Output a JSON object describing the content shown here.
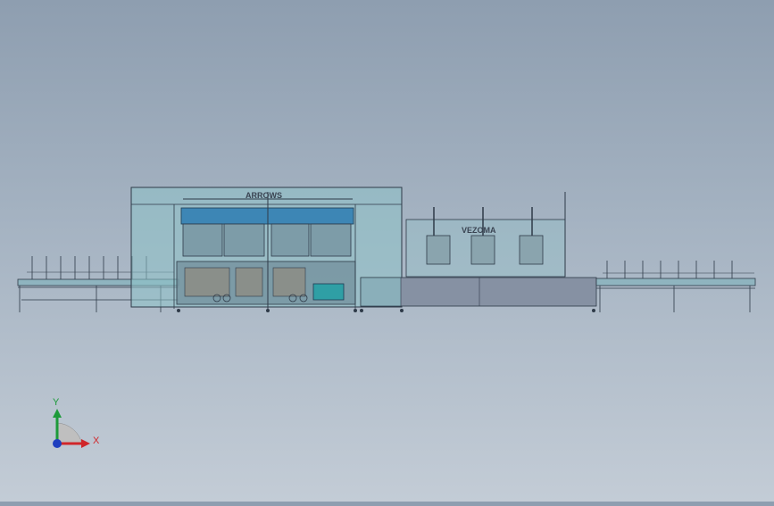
{
  "model": {
    "left_brand": "ARROWS",
    "right_brand": "VEZOMA"
  },
  "triad": {
    "x_label": "X",
    "y_label": "Y"
  },
  "colors": {
    "background_top": "#8e9eb0",
    "background_bottom": "#c3ccd6",
    "line": "#2e3a48",
    "glass": "#8ec3c9",
    "blue_panel": "#3d86b5",
    "motor": "#2f9fa5",
    "axis_x": "#d0262a",
    "axis_y": "#1d9a3a",
    "axis_z": "#1f3fbf"
  }
}
